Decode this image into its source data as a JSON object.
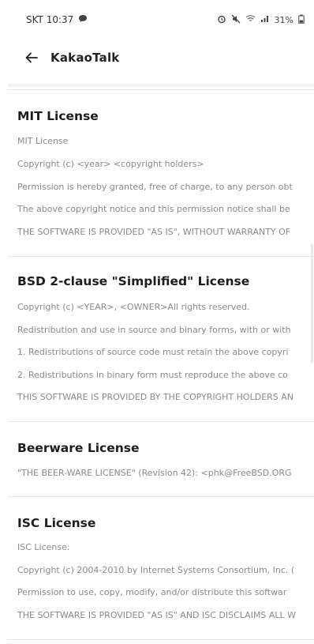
{
  "status_bar": {
    "time": "SKT 10:37",
    "battery": "31%"
  },
  "app_bar": {
    "title": "KakaoTalk"
  },
  "licenses": [
    {
      "title": "MIT License",
      "lines": [
        "MIT License",
        "Copyright (c) <year> <copyright holders>",
        "Permission is hereby granted, free of charge, to any person obt",
        "The above copyright notice and this permission notice shall be",
        "THE SOFTWARE IS PROVIDED \"AS IS\", WITHOUT WARRANTY OF"
      ]
    },
    {
      "title": "BSD 2-clause \"Simplified\" License",
      "lines": [
        "Copyright (c) <YEAR>, <OWNER>All rights reserved.",
        "Redistribution and use in source and binary forms, with or with",
        "1. Redistributions of source code must retain the above copyri",
        "2. Redistributions in binary form must reproduce the above co",
        "THIS SOFTWARE IS PROVIDED BY THE COPYRIGHT HOLDERS AN"
      ]
    },
    {
      "title": "Beerware License",
      "lines": [
        "\"THE BEER-WARE LICENSE\" (Revision 42): <phk@FreeBSD.ORG"
      ]
    },
    {
      "title": "ISC License",
      "lines": [
        "ISC License:",
        "Copyright (c) 2004-2010 by Internet Systems Consortium, Inc. (",
        "Permission to use, copy, modify, and/or distribute this softwar",
        "THE SOFTWARE IS PROVIDED \"AS IS\" AND ISC DISCLAIMS ALL W"
      ]
    }
  ]
}
